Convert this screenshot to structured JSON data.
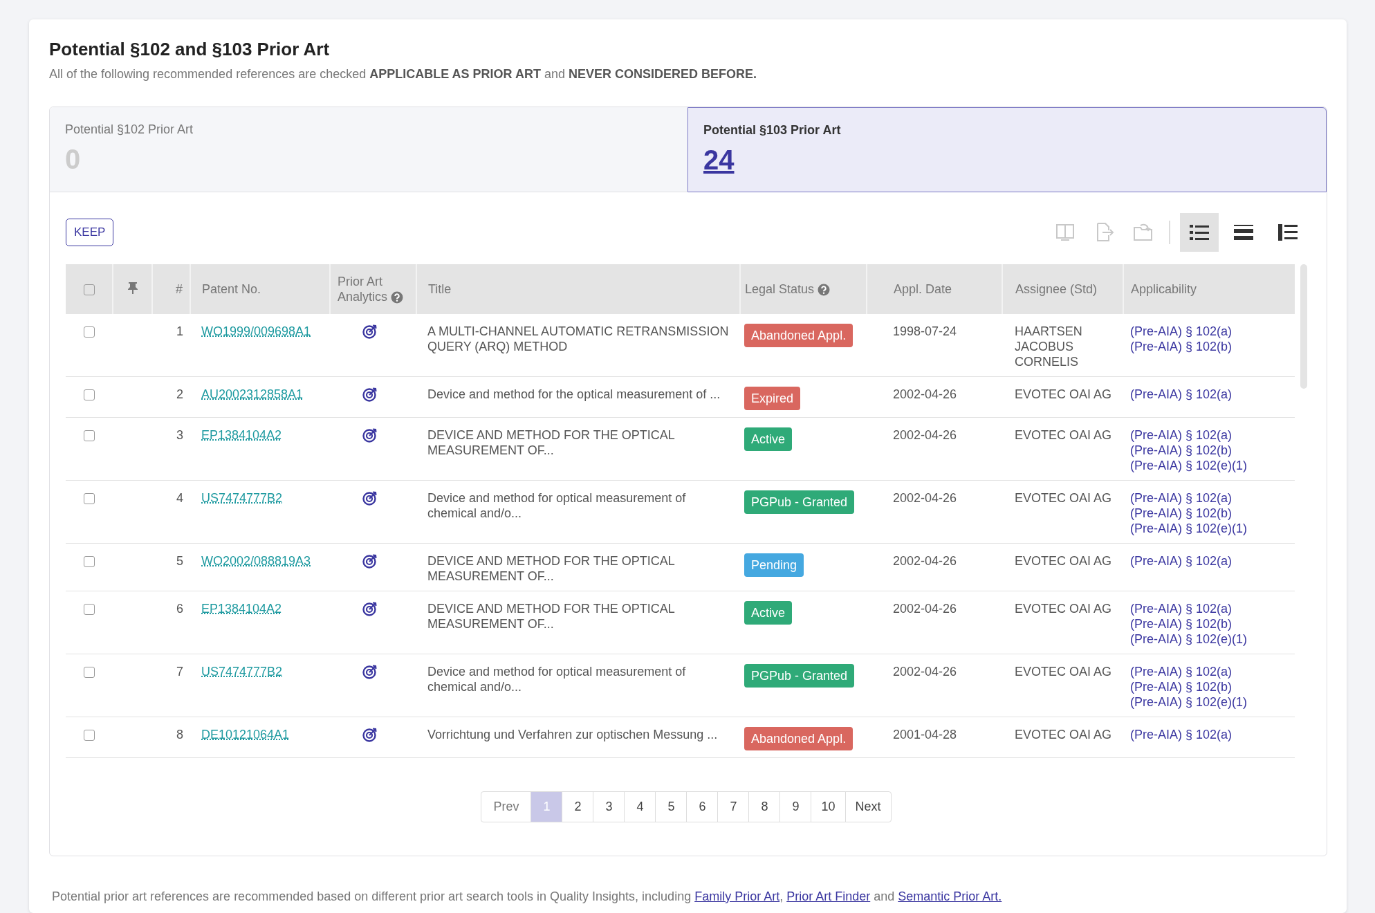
{
  "heading": {
    "title": "Potential §102 and §103 Prior Art",
    "subtitle": "All of the following recommended references are checked **APPLICABLE AS PRIOR ART** and **NEVER CONSIDERED BEFORE.**"
  },
  "tabs": [
    {
      "label": "Potential §102 Prior Art",
      "count": "0",
      "selected": false
    },
    {
      "label": "Potential §103 Prior Art",
      "count": "24",
      "selected": true
    }
  ],
  "toolbar": {
    "keep_button": "KEEP",
    "actions": [
      {
        "kind": "compare",
        "disabled": true
      },
      {
        "kind": "export",
        "disabled": true
      },
      {
        "kind": "folder",
        "disabled": true
      }
    ],
    "views": [
      {
        "kind": "list",
        "selected": true
      },
      {
        "kind": "compact",
        "selected": false
      },
      {
        "kind": "detail",
        "selected": false
      }
    ]
  },
  "table": {
    "select_all": {
      "checked": false
    },
    "columns": [
      {
        "kind": "check"
      },
      {
        "kind": "pin"
      },
      {
        "kind": "text",
        "label": "#"
      },
      {
        "kind": "text",
        "label": "Patent No."
      },
      {
        "kind": "help",
        "label": "Prior Art Analytics"
      },
      {
        "kind": "text",
        "label": "Title"
      },
      {
        "kind": "help",
        "label": "Legal Status"
      },
      {
        "kind": "text",
        "label": "Appl. Date"
      },
      {
        "kind": "text",
        "label": "Assignee (Std)"
      },
      {
        "kind": "text",
        "label": "Applicability"
      }
    ],
    "rows": [
      {
        "checked": false,
        "number": "1",
        "patent_no": "WO1999/009698A1",
        "title": "A MULTI-CHANNEL AUTOMATIC RETRANSMISSION QUERY (ARQ) METHOD",
        "status": {
          "label": "Abandoned Appl.",
          "color": "#d9675f"
        },
        "appl_date": "1998-07-24",
        "assignee": "HAARTSEN JACOBUS CORNELIS",
        "applicability": [
          "(Pre-AIA) § 102(a)",
          "(Pre-AIA) § 102(b)"
        ]
      },
      {
        "checked": false,
        "number": "2",
        "patent_no": "AU2002312858A1",
        "title": "Device and method for the optical measurement of ...",
        "status": {
          "label": "Expired",
          "color": "#d9675f"
        },
        "appl_date": "2002-04-26",
        "assignee": "EVOTEC OAI AG",
        "applicability": [
          "(Pre-AIA) § 102(a)"
        ]
      },
      {
        "checked": false,
        "number": "3",
        "patent_no": "EP1384104A2",
        "title": "DEVICE AND METHOD FOR THE OPTICAL MEASUREMENT OF...",
        "status": {
          "label": "Active",
          "color": "#2faa78"
        },
        "appl_date": "2002-04-26",
        "assignee": "EVOTEC OAI AG",
        "applicability": [
          "(Pre-AIA) § 102(a)",
          "(Pre-AIA) § 102(b)",
          "(Pre-AIA) § 102(e)(1)"
        ]
      },
      {
        "checked": false,
        "number": "4",
        "patent_no": "US7474777B2",
        "title": "Device and method for optical measurement of chemical and/o...",
        "status": {
          "label": "PGPub - Granted",
          "color": "#2faa78"
        },
        "appl_date": "2002-04-26",
        "assignee": "EVOTEC OAI AG",
        "applicability": [
          "(Pre-AIA) § 102(a)",
          "(Pre-AIA) § 102(b)",
          "(Pre-AIA) § 102(e)(1)"
        ]
      },
      {
        "checked": false,
        "number": "5",
        "patent_no": "WO2002/088819A3",
        "title": "DEVICE AND METHOD FOR THE OPTICAL MEASUREMENT OF...",
        "status": {
          "label": "Pending",
          "color": "#45a8e0"
        },
        "appl_date": "2002-04-26",
        "assignee": "EVOTEC OAI AG",
        "applicability": [
          "(Pre-AIA) § 102(a)"
        ]
      },
      {
        "checked": false,
        "number": "6",
        "patent_no": "EP1384104A2",
        "title": "DEVICE AND METHOD FOR THE OPTICAL MEASUREMENT OF...",
        "status": {
          "label": "Active",
          "color": "#2faa78"
        },
        "appl_date": "2002-04-26",
        "assignee": "EVOTEC OAI AG",
        "applicability": [
          "(Pre-AIA) § 102(a)",
          "(Pre-AIA) § 102(b)",
          "(Pre-AIA) § 102(e)(1)"
        ]
      },
      {
        "checked": false,
        "number": "7",
        "patent_no": "US7474777B2",
        "title": "Device and method for optical measurement of chemical and/o...",
        "status": {
          "label": "PGPub - Granted",
          "color": "#2faa78"
        },
        "appl_date": "2002-04-26",
        "assignee": "EVOTEC OAI AG",
        "applicability": [
          "(Pre-AIA) § 102(a)",
          "(Pre-AIA) § 102(b)",
          "(Pre-AIA) § 102(e)(1)"
        ]
      },
      {
        "checked": false,
        "number": "8",
        "patent_no": "DE10121064A1",
        "title": "Vorrichtung und Verfahren zur optischen Messung ...",
        "status": {
          "label": "Abandoned Appl.",
          "color": "#d9675f"
        },
        "appl_date": "2001-04-28",
        "assignee": "EVOTEC OAI AG",
        "applicability": [
          "(Pre-AIA) § 102(a)"
        ]
      }
    ]
  },
  "pagination": {
    "prev": "Prev",
    "next": "Next",
    "pages": [
      {
        "label": "1",
        "selected": true
      },
      {
        "label": "2",
        "selected": false
      },
      {
        "label": "3",
        "selected": false
      },
      {
        "label": "4",
        "selected": false
      },
      {
        "label": "5",
        "selected": false
      },
      {
        "label": "6",
        "selected": false
      },
      {
        "label": "7",
        "selected": false
      },
      {
        "label": "8",
        "selected": false
      },
      {
        "label": "9",
        "selected": false
      },
      {
        "label": "10",
        "selected": false
      }
    ]
  },
  "footer": {
    "text": "Potential prior art references are recommended based on different prior art search tools in Quality Insights, including",
    "links": [
      "Family Prior Art",
      "Prior Art Finder",
      "Semantic Prior Art."
    ],
    "separators": [
      ",",
      "and"
    ]
  }
}
